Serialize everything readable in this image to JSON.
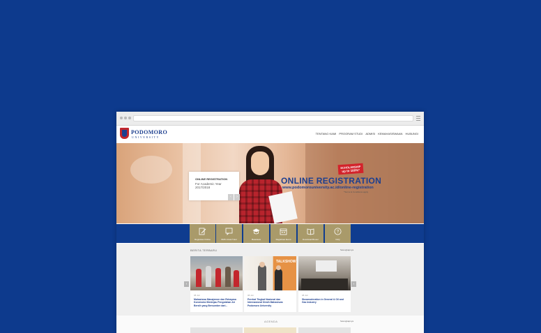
{
  "browser": {
    "address": ""
  },
  "header": {
    "logo_name": "PODOMORO",
    "logo_sub": "UNIVERSITY",
    "nav": [
      "TENTANG KAMI",
      "PROGRAM STUDI",
      "ADMISI",
      "KEMAHASISWAAN",
      "HUBUNGI"
    ]
  },
  "hero": {
    "reg_title": "ONLINE REGISTRATION",
    "reg_subtitle": "For Academic Year",
    "reg_year": "2017/2018",
    "scholarship_line1": "SCHOLARSHIP",
    "scholarship_line2": "up to 100%*",
    "big_title": "ONLINE REGISTRATION",
    "url": "www.podomorouniversity.ac.id/online-registration",
    "url_note": "*Terms & Conditions apply",
    "prev_arrow": "‹",
    "next_arrow": "›"
  },
  "quick_links": [
    {
      "label": "Registrasi Online",
      "icon": "edit-icon"
    },
    {
      "label": "SMS Untuk Tutor",
      "icon": "chat-icon"
    },
    {
      "label": "Beasiswa",
      "icon": "graduation-cap-icon"
    },
    {
      "label": "Registrasi Event",
      "icon": "calendar-icon"
    },
    {
      "label": "Download Brosur",
      "icon": "book-icon"
    },
    {
      "label": "FAQ",
      "icon": "question-icon"
    }
  ],
  "news": {
    "heading": "BERITA TERBARU",
    "more": "Selengkapnya",
    "cards": [
      {
        "date": "08 Juli",
        "title": "Mahasiswa Manajemen dan Rekayasa Konstruksi Meninjau Pengolahan Air Bersih yang Bersumber dari..."
      },
      {
        "date": "08 Juli",
        "title": "Perekat Tingkat Nasional dan Internasional Diraih Mahasiswa Podomoro University"
      },
      {
        "date": "08 Juli",
        "title": "Stuwmoderation in General & Oil and Gas Industry"
      }
    ],
    "prev_arrow": "‹",
    "next_arrow": "›",
    "talkshow": "TALKSHOW"
  },
  "agenda": {
    "heading": "AGENDA",
    "more": "Selengkapnya"
  }
}
